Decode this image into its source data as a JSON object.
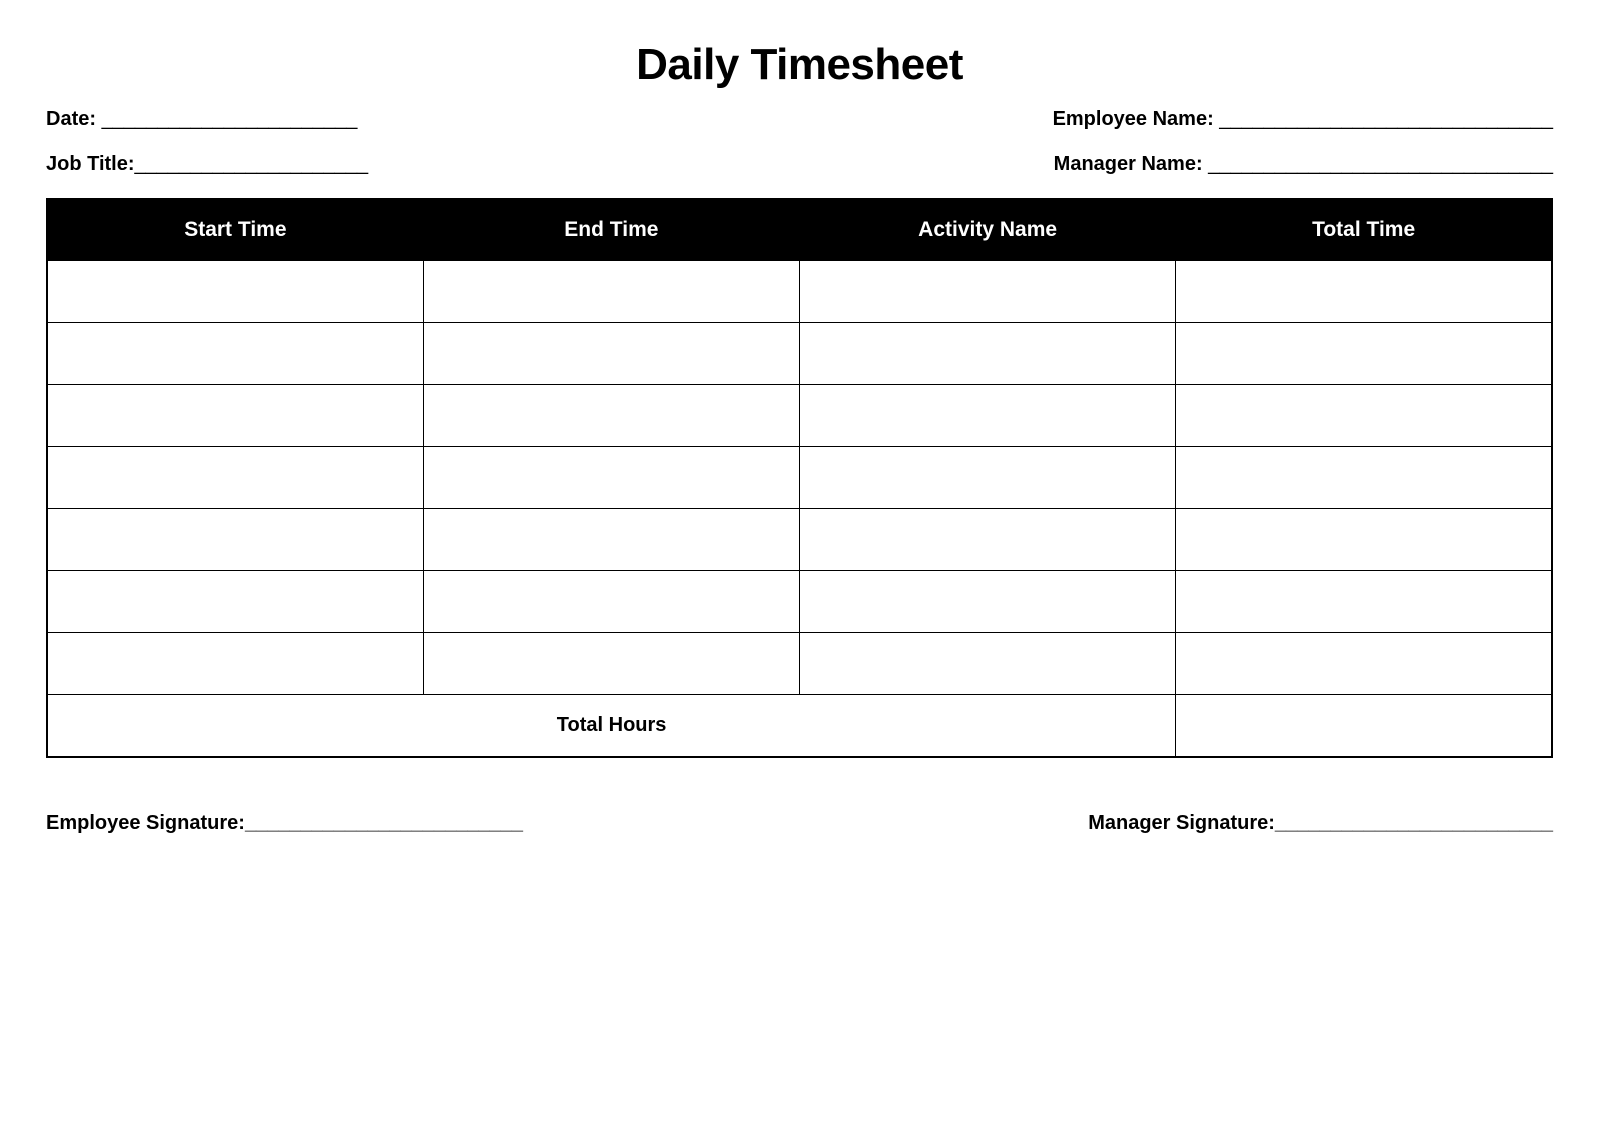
{
  "title": "Daily Timesheet",
  "fields": {
    "date_label": "Date: ",
    "date_line": "_______________________",
    "employee_name_label": "Employee Name: ",
    "employee_name_line": "______________________________",
    "job_title_label": "Job Title:",
    "job_title_line": "_____________________",
    "manager_name_label": "Manager Name: ",
    "manager_name_line": "_______________________________",
    "employee_sig_label": "Employee Signature:",
    "employee_sig_line": "_________________________",
    "manager_sig_label": "Manager Signature:",
    "manager_sig_line": "_________________________"
  },
  "table": {
    "headers": [
      "Start Time",
      "End Time",
      "Activity Name",
      "Total Time"
    ],
    "rows": 7,
    "total_label": "Total Hours"
  }
}
